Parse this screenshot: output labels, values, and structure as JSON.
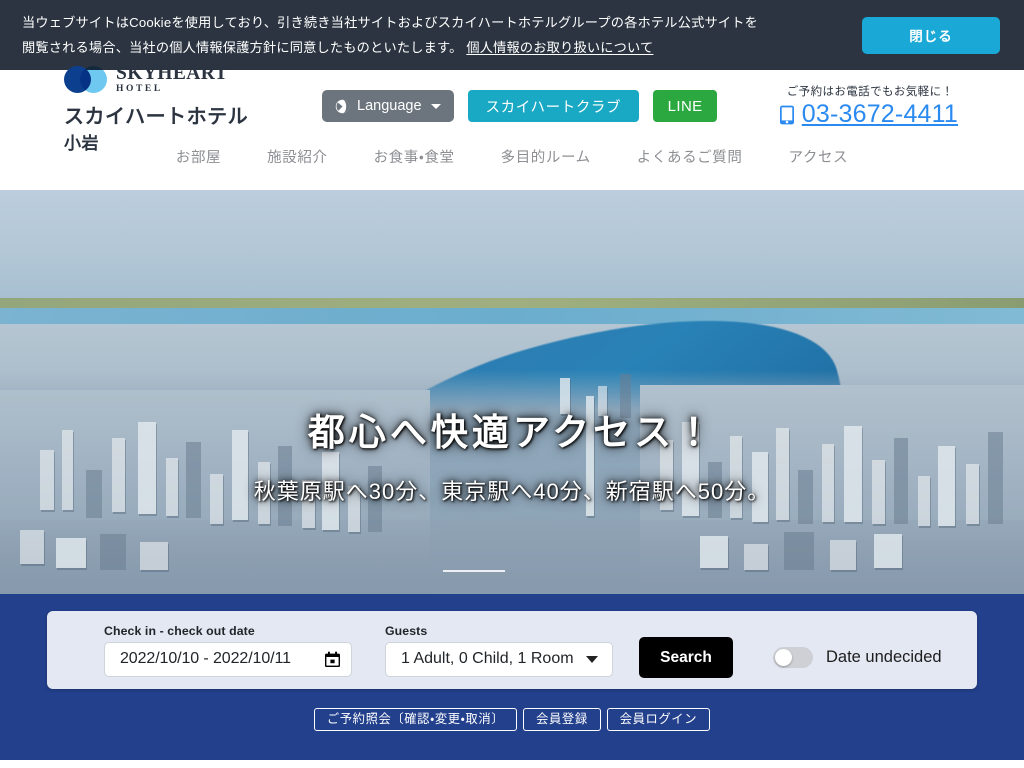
{
  "cookie_banner": {
    "line1": "当ウェブサイトはCookieを使用しており、引き続き当社サイトおよびスカイハートホテルグループの各ホテル公式サイトを",
    "line2": "閲覧される場合、当社の個人情報保護方針に同意したものといたします。",
    "policy_link": "個人情報のお取り扱いについて",
    "close_label": "閉じる"
  },
  "header": {
    "logo": {
      "brand_main": "SKY",
      "brand_main_2": "HEART",
      "brand_sub": "HOTEL",
      "brand_jp": "スカイハートホテル",
      "brand_jp_tail": "小岩"
    },
    "language_button": "Language",
    "club_button": "スカイハートクラブ",
    "line_button": "LINE",
    "phone_lead": "ご予約はお電話でもお気軽に！",
    "phone_number": "03-3672-4411",
    "nav": [
      {
        "label": "お部屋"
      },
      {
        "label": "施設紹介"
      },
      {
        "label": "お食事・食堂"
      },
      {
        "label": "多目的ルーム"
      },
      {
        "label": "よくあるご質問"
      },
      {
        "label": "アクセス"
      }
    ]
  },
  "hero": {
    "title": "都心へ快適アクセス！",
    "subtitle": "秋葉原駅へ30分、東京駅へ40分、新宿駅へ50分。"
  },
  "booking": {
    "date_label": "Check in - check out date",
    "date_value": "2022/10/10 - 2022/10/11",
    "guests_label": "Guests",
    "guests_value": "1 Adult, 0 Child, 1 Room",
    "search_label": "Search",
    "undecided_label": "Date undecided",
    "undecided_state": "off",
    "member_buttons": [
      {
        "label": "ご予約照会〔確認・変更・取消〕"
      },
      {
        "label": "会員登録"
      },
      {
        "label": "会員ログイン"
      }
    ]
  },
  "colors": {
    "cookie_bg": "#2b3440",
    "cookie_accent": "#1aa9d6",
    "booking_band": "#23408c",
    "panel_bg": "#e4e8f3",
    "club_teal": "#1aa9c4",
    "line_green": "#2ba83f",
    "phone_blue": "#2a8af0",
    "language_gray": "#6c757d"
  }
}
